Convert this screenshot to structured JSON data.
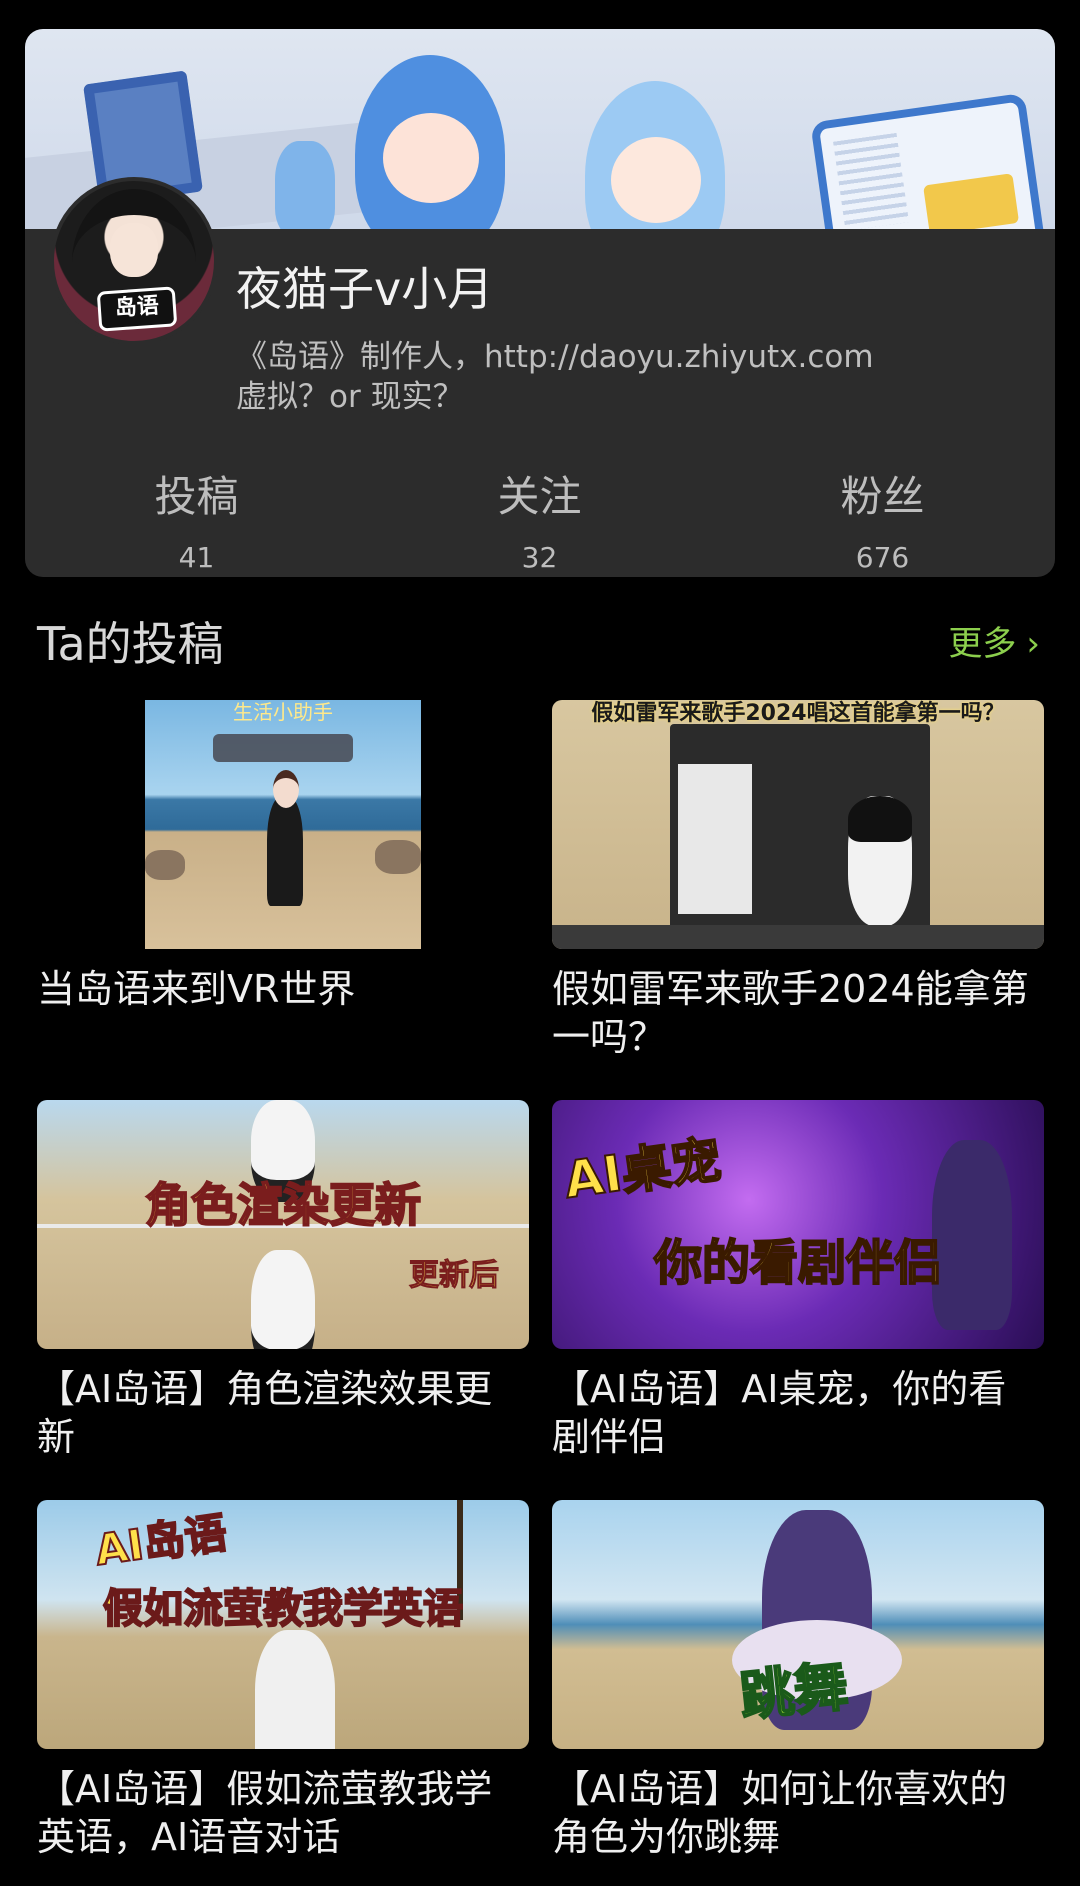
{
  "profile": {
    "username": "夜猫子v小月",
    "bio_line1": "《岛语》制作人，http://daoyu.zhiyutx.com",
    "bio_line2": "虚拟？or 现实？",
    "avatar_badge": "岛语",
    "stats": [
      {
        "label": "投稿",
        "value": "41"
      },
      {
        "label": "关注",
        "value": "32"
      },
      {
        "label": "粉丝",
        "value": "676"
      }
    ]
  },
  "section": {
    "title": "Ta的投稿",
    "more_label": "更多",
    "more_icon": "chevron-right-icon",
    "accent_color": "#8ccf4d"
  },
  "videos": [
    {
      "title": "当岛语来到VR世界",
      "thumb_text": "生活小助手"
    },
    {
      "title": "假如雷军来歌手2024能拿第一吗？",
      "thumb_text": "假如雷军来歌手2024唱这首能拿第一吗？"
    },
    {
      "title": "【AI岛语】角色渲染效果更新",
      "thumb_text": "角色渲染更新",
      "thumb_subtext": "更新后"
    },
    {
      "title": "【AI岛语】AI桌宠，你的看剧伴侣",
      "thumb_text": "AI桌宠",
      "thumb_subtext": "你的看剧伴侣"
    },
    {
      "title": "【AI岛语】假如流萤教我学英语，AI语音对话",
      "thumb_text": "AI岛语",
      "thumb_subtext": "假如流萤教我学英语"
    },
    {
      "title": "【AI岛语】如何让你喜欢的角色为你跳舞",
      "thumb_text": "跳舞"
    }
  ]
}
